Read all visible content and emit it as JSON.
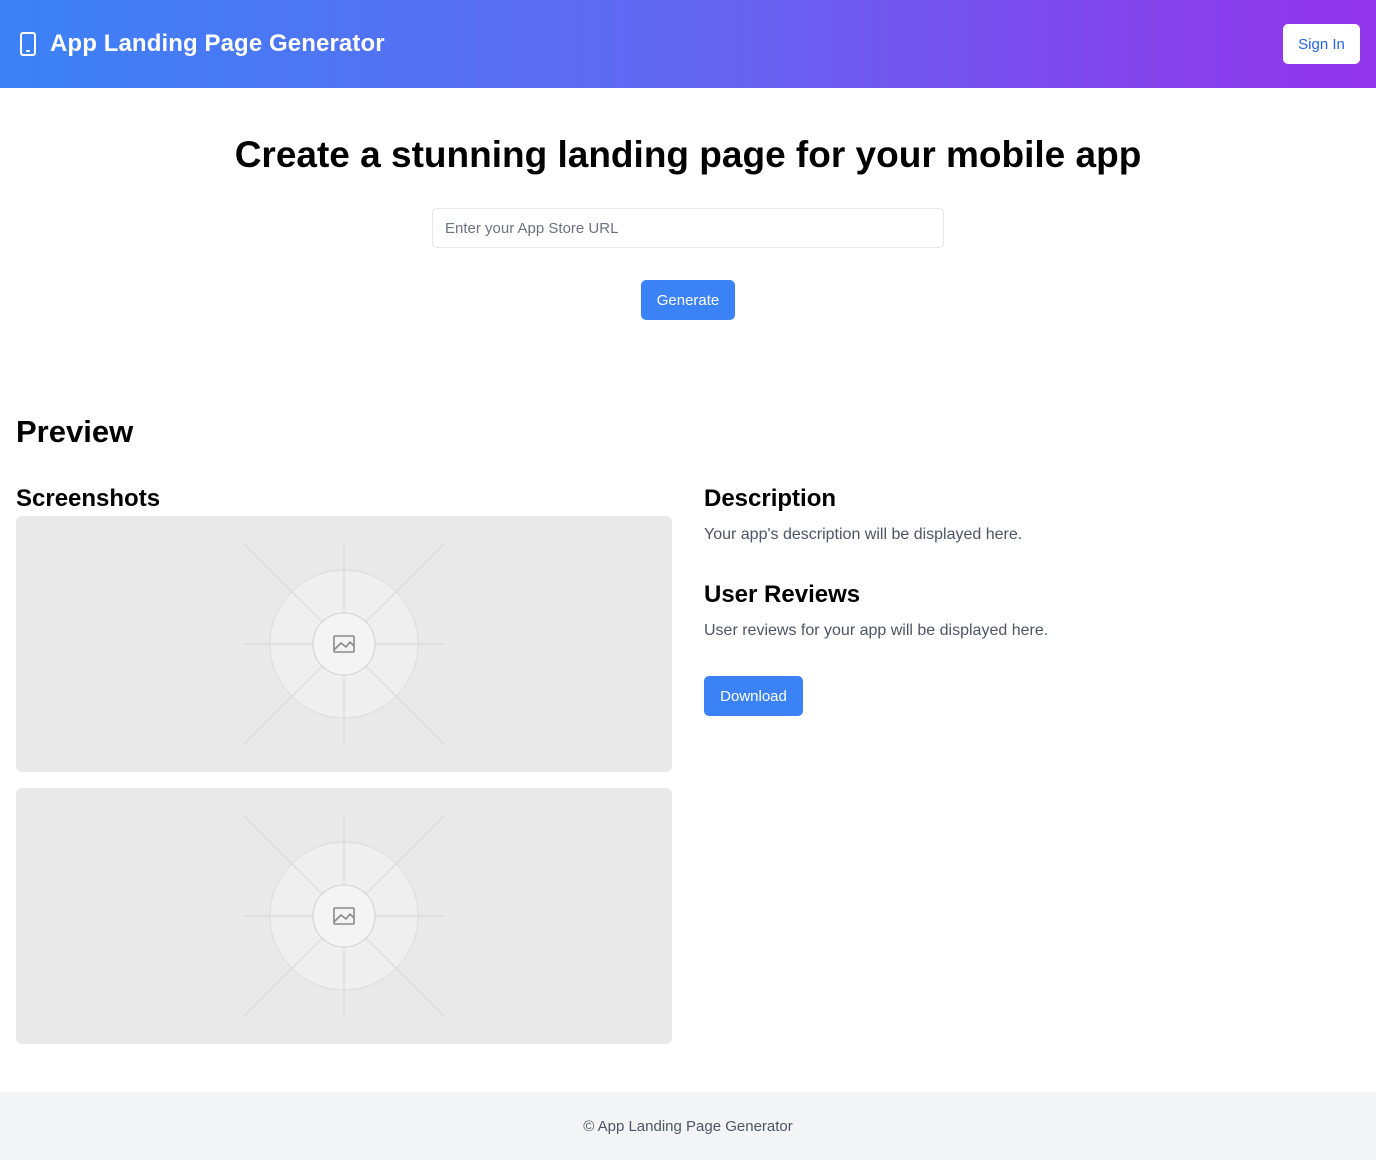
{
  "header": {
    "brand_icon": "smartphone-icon",
    "title": "App Landing Page Generator",
    "signin_label": "Sign In",
    "gradient_start": "#3b82f6",
    "gradient_end": "#9333ea"
  },
  "hero": {
    "title": "Create a stunning landing page for your mobile app",
    "url_input": {
      "value": "",
      "placeholder": "Enter your App Store URL"
    },
    "generate_label": "Generate"
  },
  "preview": {
    "title": "Preview",
    "screenshots": {
      "title": "Screenshots",
      "items": [
        {
          "icon": "image-placeholder-icon"
        },
        {
          "icon": "image-placeholder-icon"
        }
      ]
    },
    "description": {
      "title": "Description",
      "text": "Your app's description will be displayed here."
    },
    "reviews": {
      "title": "User Reviews",
      "text": "User reviews for your app will be displayed here."
    },
    "download_label": "Download"
  },
  "footer": {
    "text": "© App Landing Page Generator"
  },
  "colors": {
    "accent": "#3b82f6",
    "muted_text": "#4b5563",
    "placeholder_bg": "#e9e9e9",
    "footer_bg": "#f3f4f6"
  }
}
